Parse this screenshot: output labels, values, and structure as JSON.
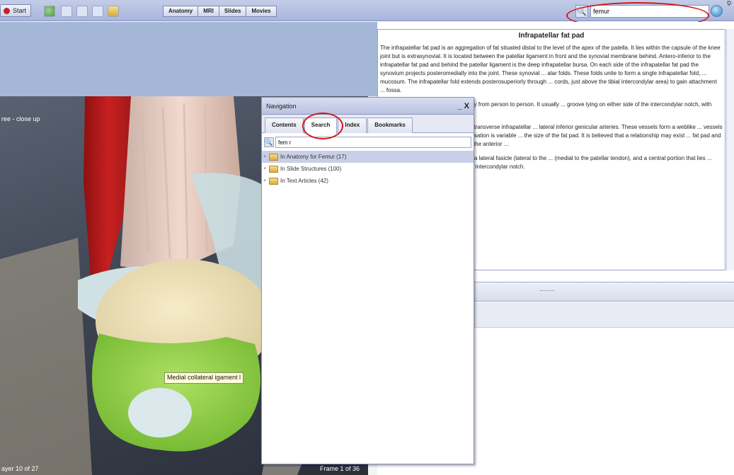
{
  "corner_label": "סָ",
  "toolbar": {
    "start_label": "Start",
    "tabs": [
      {
        "label": "Anatomy"
      },
      {
        "label": "MRI"
      },
      {
        "label": "Slides"
      },
      {
        "label": "Movies"
      }
    ],
    "search_value": "femur"
  },
  "viewer": {
    "caption": "ree - close up",
    "tooltip": "Medial collateral igament l",
    "footer_left": "ayer 10 of 27",
    "footer_right": "Frame 1 of 36"
  },
  "article": {
    "title": "Infrapatellar fat pad",
    "paragraphs": [
      "The infrapatellar fat pad is an aggregation of fat situated distal to the level of the apex of the patella. It lies within the capsule of the knee joint but is extrasynovial. It is located between the patellar ligament in front and the synovial membrane behind. Antero-inferior to the infrapatellar fat pad and behind the patellar ligament is the deep infrapatellar bursa. On each side of the infrapatellar fat pad the synovium projects posteromedially into the joint. These synovial ... alar folds. These folds unite to form a single infrapatellar fold, ... mucosum. The infrapatellar fold extends posterosuperiorly through ... cords, just above the tibial intercondylar area) to gain attachment ... fossa.",
      "... size of the fat pad vary considerably from person to person. It usually ... groove lying on either side of the intercondylar notch, with these to ... each bony prominence.",
      "... patellar fat pad is derived from the transverse infrapatellar ... lateral inferior genicular arteries. These vessels form a weblike ... vessels to fat pad. The extent of this vascularisation is variable ... the size of the fat pad. It is believed that a relationship may exist ... fat pad and its contribution to the blood supply of the anterior ...",
      "... describe the fat pad as comprising a lateral fasicle (lateral to the ... (medial to the patellar tendon), and a central portion that lies ... from a ridge anterior to the roof of the intercondylar notch."
    ]
  },
  "nav_panel": {
    "title": "Navigation",
    "minimize_glyph": "_",
    "close_glyph": "X",
    "tabs": [
      {
        "label": "Contents"
      },
      {
        "label": "Search"
      },
      {
        "label": "Index"
      },
      {
        "label": "Bookmarks"
      }
    ],
    "search_value": "fem r",
    "results": [
      {
        "label": "In Anatomy for Femur (17)"
      },
      {
        "label": "In Slide Structures (100)"
      },
      {
        "label": "In Text Articles (42)"
      }
    ]
  },
  "colors": {
    "toolbar_bg": "#b5c1e3",
    "highlight_oval": "#d01818",
    "tooltip_bg": "#ffffd8",
    "selected_row": "#c9cfe8",
    "left_panel_bg": "#a5b7d7"
  }
}
